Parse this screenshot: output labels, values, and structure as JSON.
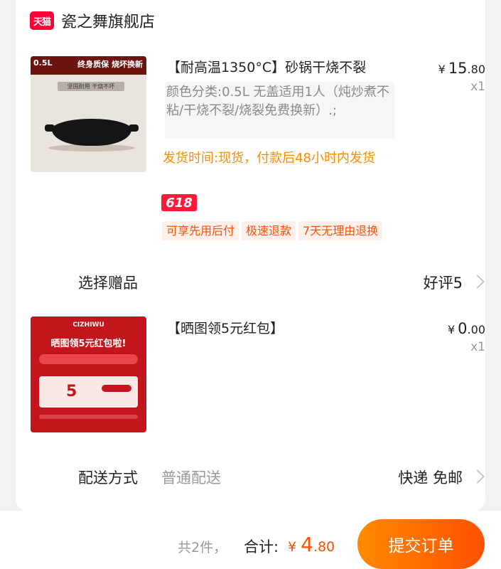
{
  "store": {
    "logo_text": "天猫",
    "name": "瓷之舞旗舰店"
  },
  "items": [
    {
      "image": {
        "volume": "0.5L",
        "slogan": "终身质保 烧坏换新",
        "strip": "坚固耐用 干烧不坏"
      },
      "title": "【耐高温1350°C】砂锅干烧不裂",
      "variant": "颜色分类:0.5L 无盖适用1人（炖炒煮不粘/干烧不裂/烧裂免费换新）.;",
      "ship_time": "发货时间:现货，付款后48小时内发货",
      "promo_badge": "618",
      "tags": [
        "可享先用后付",
        "极速退款",
        "7天无理由退换"
      ],
      "price": {
        "currency": "¥",
        "yuan": "15",
        "cents": ".80"
      },
      "quantity": "x1"
    },
    {
      "image": {
        "brand": "CIZHIWU",
        "headline": "晒图领5元红包啦!",
        "coupon_value": "5"
      },
      "title": "【晒图领5元红包】",
      "price": {
        "currency": "¥",
        "yuan": "0",
        "cents": ".00"
      },
      "quantity": "x1"
    }
  ],
  "gift": {
    "label": "选择赠品",
    "value": "好评5"
  },
  "shipping": {
    "label": "配送方式",
    "method": "普通配送",
    "value": "快递 免邮"
  },
  "footer": {
    "count_text": "共2件，",
    "total_label": "合计:",
    "total": {
      "currency": "¥",
      "yuan": "4",
      "cents": ".80"
    },
    "submit_label": "提交订单"
  },
  "colors": {
    "accent": "#ff5000",
    "tmall": "#ff0036",
    "ship_time": "#ff8a00"
  }
}
